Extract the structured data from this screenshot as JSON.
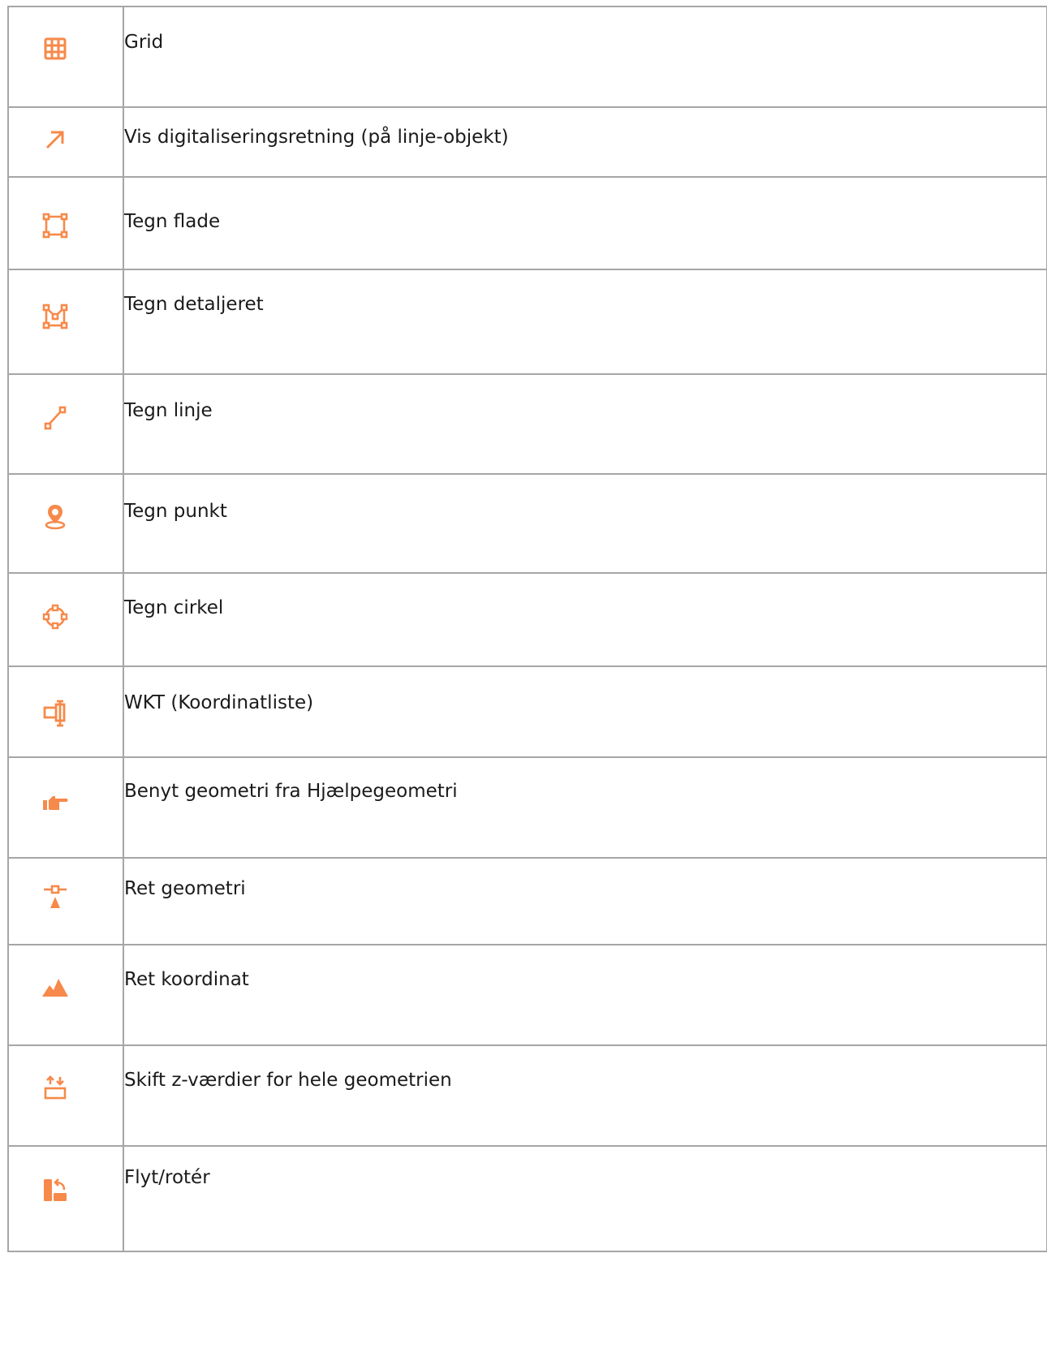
{
  "accent_color": "#f7894a",
  "rows": [
    {
      "icon": "grid-icon",
      "label": "Grid"
    },
    {
      "icon": "arrow-up-right-icon",
      "label": "Vis digitaliseringsretning (på linje-objekt)"
    },
    {
      "icon": "polygon-draw-icon",
      "label": "Tegn flade"
    },
    {
      "icon": "polygon-detailed-draw-icon",
      "label": "Tegn detaljeret"
    },
    {
      "icon": "line-draw-icon",
      "label": "Tegn linje"
    },
    {
      "icon": "map-marker-icon",
      "label": "Tegn punkt"
    },
    {
      "icon": "circle-draw-icon",
      "label": "Tegn cirkel"
    },
    {
      "icon": "text-cursor-box-icon",
      "label": "WKT (Koordinatliste)"
    },
    {
      "icon": "hand-pointing-icon",
      "label": "Benyt geometri fra Hjælpegeometri"
    },
    {
      "icon": "vertex-edit-icon",
      "label": "Ret geometri"
    },
    {
      "icon": "mountains-icon",
      "label": "Ret koordinat"
    },
    {
      "icon": "swap-z-values-icon",
      "label": "Skift z-værdier for hele geometrien"
    },
    {
      "icon": "move-rotate-icon",
      "label": "Flyt/rotér"
    }
  ]
}
